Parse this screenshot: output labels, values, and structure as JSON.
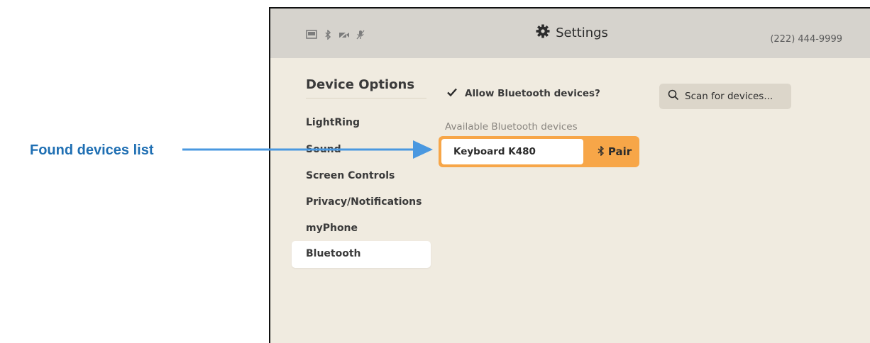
{
  "callout": {
    "label": "Found devices list"
  },
  "header": {
    "title": "Settings",
    "phone_number": "(222) 444-9999",
    "status_icons": [
      "display-icon",
      "bluetooth-icon",
      "camera-off-icon",
      "mic-off-icon"
    ]
  },
  "sidebar": {
    "heading": "Device Options",
    "items": [
      {
        "label": "LightRing"
      },
      {
        "label": "Sound"
      },
      {
        "label": "Screen Controls"
      },
      {
        "label": "Privacy/Notifications"
      },
      {
        "label": "myPhone"
      },
      {
        "label": "Bluetooth",
        "selected": true
      }
    ]
  },
  "bluetooth": {
    "allow_label": "Allow Bluetooth devices?",
    "allow_checked": true,
    "scan_label": "Scan for devices...",
    "available_label": "Available Bluetooth devices",
    "devices": [
      {
        "name": "Keyboard K480",
        "action": "Pair"
      }
    ]
  },
  "colors": {
    "callout": "#1f6fb3",
    "arrow": "#4a98e0",
    "accent": "#f7a648",
    "background": "#f0ebe0",
    "header": "#d6d3cd"
  }
}
